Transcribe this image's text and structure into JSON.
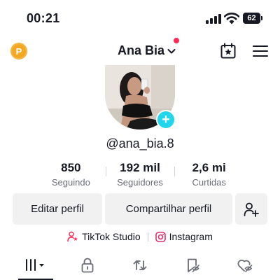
{
  "status_bar": {
    "time": "00:21",
    "battery": "62"
  },
  "header": {
    "points_badge": "P",
    "username": "Ana Bia",
    "icons": [
      "points-icon",
      "chevron-down-icon",
      "calendar-star-icon",
      "menu-icon"
    ],
    "notification_color": "#fe2c55"
  },
  "profile": {
    "handle": "@ana_bia.8",
    "add_avatar_symbol": "+"
  },
  "stats": [
    {
      "value": "850",
      "label": "Seguindo"
    },
    {
      "value": "192 mil",
      "label": "Seguidores"
    },
    {
      "value": "2,6 mi",
      "label": "Curtidas"
    }
  ],
  "actions": {
    "edit_label": "Editar perfil",
    "share_label": "Compartilhar perfil",
    "add_friend_icon": "add-friend-icon"
  },
  "links": {
    "studio_label": "TikTok Studio",
    "instagram_label": "Instagram"
  },
  "tabs": [
    "videos-grid-icon",
    "lock-icon",
    "repost-icon",
    "saved-icon",
    "liked-icon"
  ],
  "colors": {
    "accent_cyan": "#20d5ec",
    "accent_red": "#fe2c55",
    "points_gold": "#f5a623",
    "button_bg": "#f1f1f2",
    "muted_text": "#6b6d75"
  }
}
